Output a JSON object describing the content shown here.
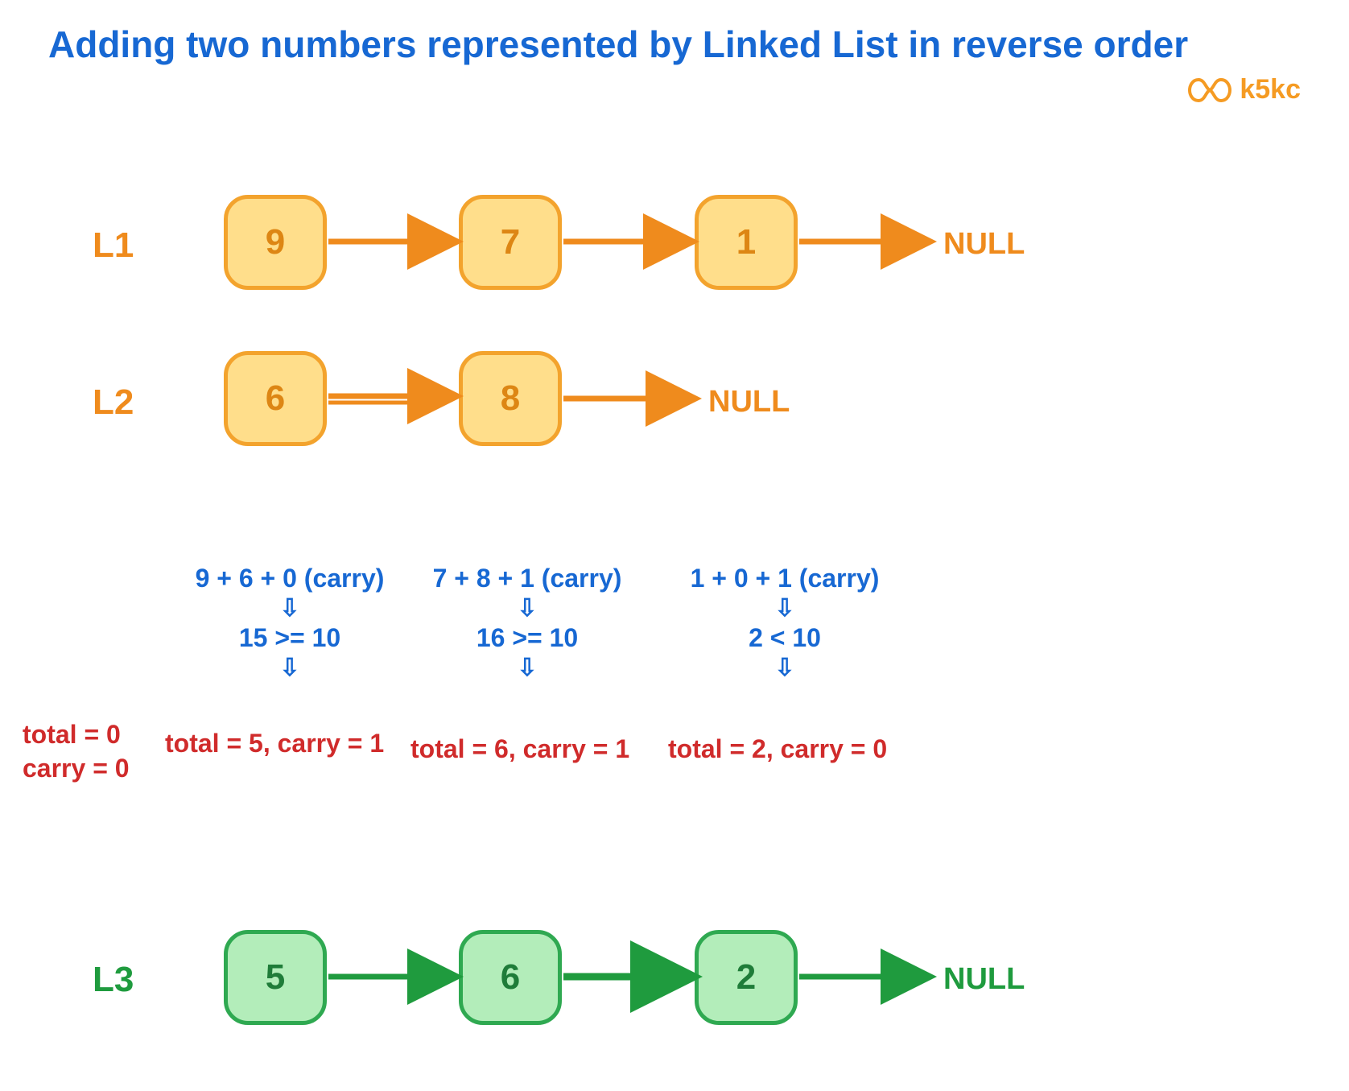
{
  "title": "Adding two numbers represented by Linked List in reverse order",
  "brand": "k5kc",
  "labels": {
    "L1": "L1",
    "L2": "L2",
    "L3": "L3",
    "null": "NULL"
  },
  "L1": {
    "nodes": [
      "9",
      "7",
      "1"
    ]
  },
  "L2": {
    "nodes": [
      "6",
      "8"
    ]
  },
  "L3": {
    "nodes": [
      "5",
      "6",
      "2"
    ]
  },
  "init": {
    "total": "total = 0",
    "carry": "carry = 0"
  },
  "steps": [
    {
      "expr": "9 + 6 + 0 (carry)",
      "cmp": "15 >= 10",
      "res": "total = 5, carry = 1"
    },
    {
      "expr": "7 + 8 + 1 (carry)",
      "cmp": "16 >= 10",
      "res": "total = 6, carry = 1"
    },
    {
      "expr": "1 + 0 + 1 (carry)",
      "cmp": "2 < 10",
      "res": "total = 2, carry = 0"
    }
  ]
}
